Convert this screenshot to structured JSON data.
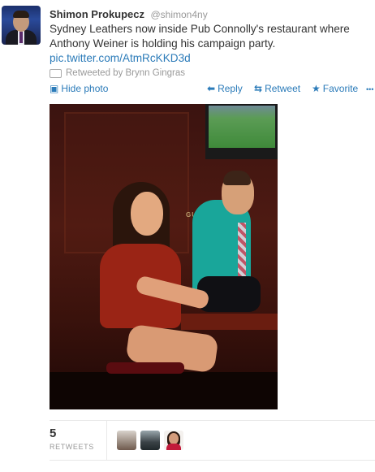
{
  "tweet": {
    "author_name": "Shimon Prokupecz",
    "author_handle": "@shimon4ny",
    "text": "Sydney Leathers now inside Pub Connolly's restaurant where Anthony Weiner is holding his campaign party.",
    "link": "pic.twitter.com/AtmRcKKD3d",
    "retweeted_by": "Retweeted by Brynn Gingras"
  },
  "actions": {
    "hide_photo": "Hide photo",
    "reply": "Reply",
    "retweet": "Retweet",
    "favorite": "Favorite",
    "more": "•••"
  },
  "photo": {
    "sign_text": "GUINNESS"
  },
  "stats": {
    "retweet_count": "5",
    "retweet_label": "RETWEETS"
  },
  "colors": {
    "link_blue": "#2b7bb9",
    "text": "#333333",
    "muted": "#999999"
  }
}
